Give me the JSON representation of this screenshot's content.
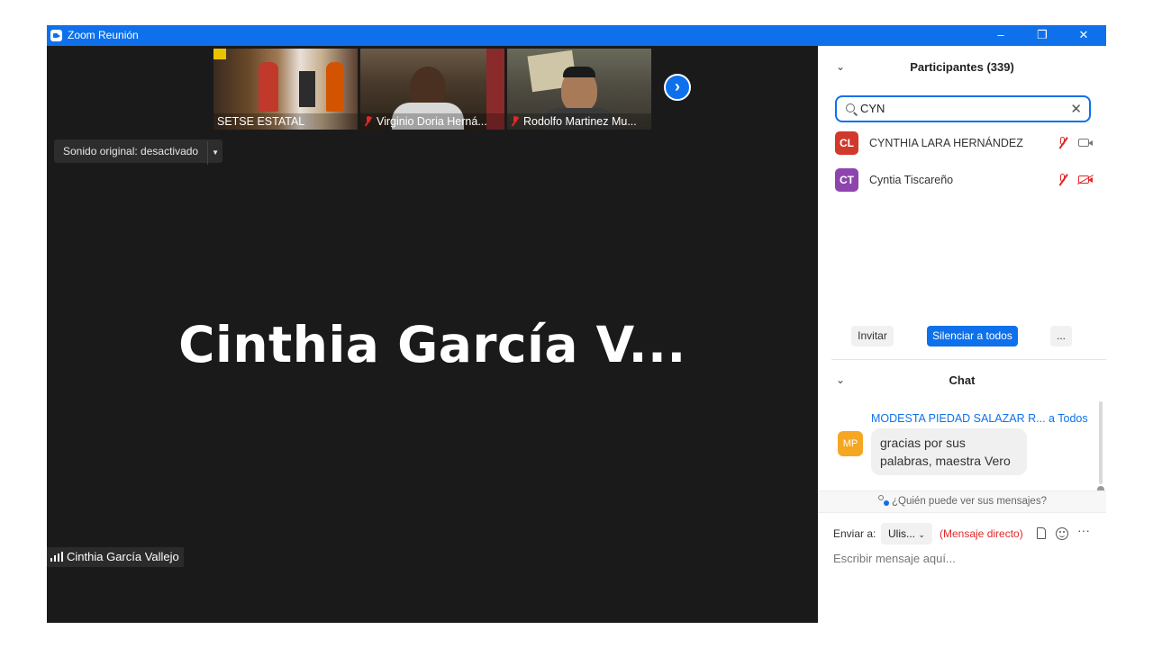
{
  "window": {
    "title": "Zoom Reunión",
    "controls": {
      "minimize": "–",
      "restore": "❐",
      "close": "✕"
    }
  },
  "gallery": {
    "thumbnails": [
      {
        "label": "SETSE ESTATAL",
        "muted": false
      },
      {
        "label": "Virginio Doria Herná...",
        "muted": true
      },
      {
        "label": "Rodolfo Martinez Mu...",
        "muted": true
      }
    ],
    "next_icon": "chevron-right-icon"
  },
  "audio": {
    "original_sound_label": "Sonido original: desactivado"
  },
  "active_speaker": {
    "big_name": "Cinthia García V...",
    "name_tag": "Cinthia García Vallejo"
  },
  "participants": {
    "header": "Participantes (339)",
    "search_value": "CYN",
    "list": [
      {
        "initials": "CL",
        "name": "CYNTHIA LARA HERNÁNDEZ",
        "color": "#d0392b",
        "video_off": false
      },
      {
        "initials": "CT",
        "name": "Cyntia Tiscareño",
        "color": "#8e44ad",
        "video_off": true
      }
    ],
    "invite_label": "Invitar",
    "mute_all_label": "Silenciar a todos",
    "more_label": "..."
  },
  "chat": {
    "header": "Chat",
    "messages": [
      {
        "sender": "MODESTA PIEDAD SALAZAR R...",
        "to": "a Todos",
        "initials": "MP",
        "text": "gracias por sus palabras, maestra Vero"
      }
    ],
    "who_can_see": "¿Quién puede ver sus mensajes?",
    "send_to_label": "Enviar a:",
    "send_to_value": "Ulis...",
    "direct_label": "(Mensaje directo)",
    "more_label": "···",
    "input_placeholder": "Escribir mensaje aquí..."
  },
  "colors": {
    "accent": "#0e71eb",
    "muted_red": "#e02828"
  }
}
